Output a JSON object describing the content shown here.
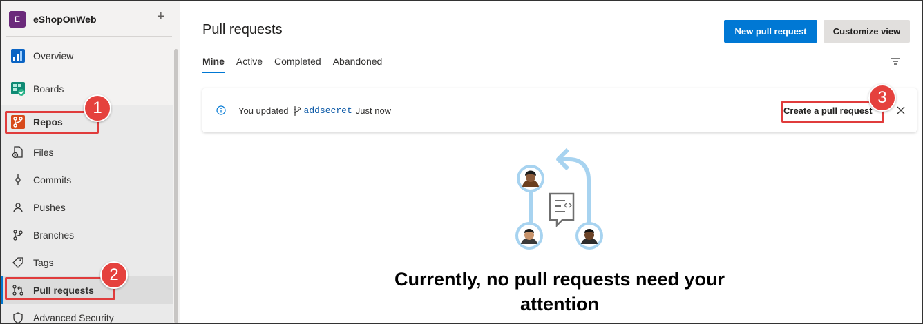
{
  "project": {
    "initial": "E",
    "name": "eShopOnWeb",
    "add_symbol": "+"
  },
  "nav": {
    "overview": "Overview",
    "boards": "Boards",
    "repos": "Repos",
    "files": "Files",
    "commits": "Commits",
    "pushes": "Pushes",
    "branches": "Branches",
    "tags": "Tags",
    "pull_requests": "Pull requests",
    "advanced_security": "Advanced Security"
  },
  "header": {
    "title": "Pull requests",
    "new_pr_button": "New pull request",
    "customize_button": "Customize view"
  },
  "tabs": [
    "Mine",
    "Active",
    "Completed",
    "Abandoned"
  ],
  "banner": {
    "prefix": "You updated",
    "branch": "addsecret",
    "suffix": "Just now",
    "action": "Create a pull request"
  },
  "empty_state": {
    "line1": "Currently, no pull requests need your",
    "line2": "attention"
  },
  "callouts": [
    "1",
    "2",
    "3"
  ],
  "colors": {
    "accent": "#0078d4",
    "callout": "#e5413d",
    "project_badge": "#6b2a7b"
  }
}
